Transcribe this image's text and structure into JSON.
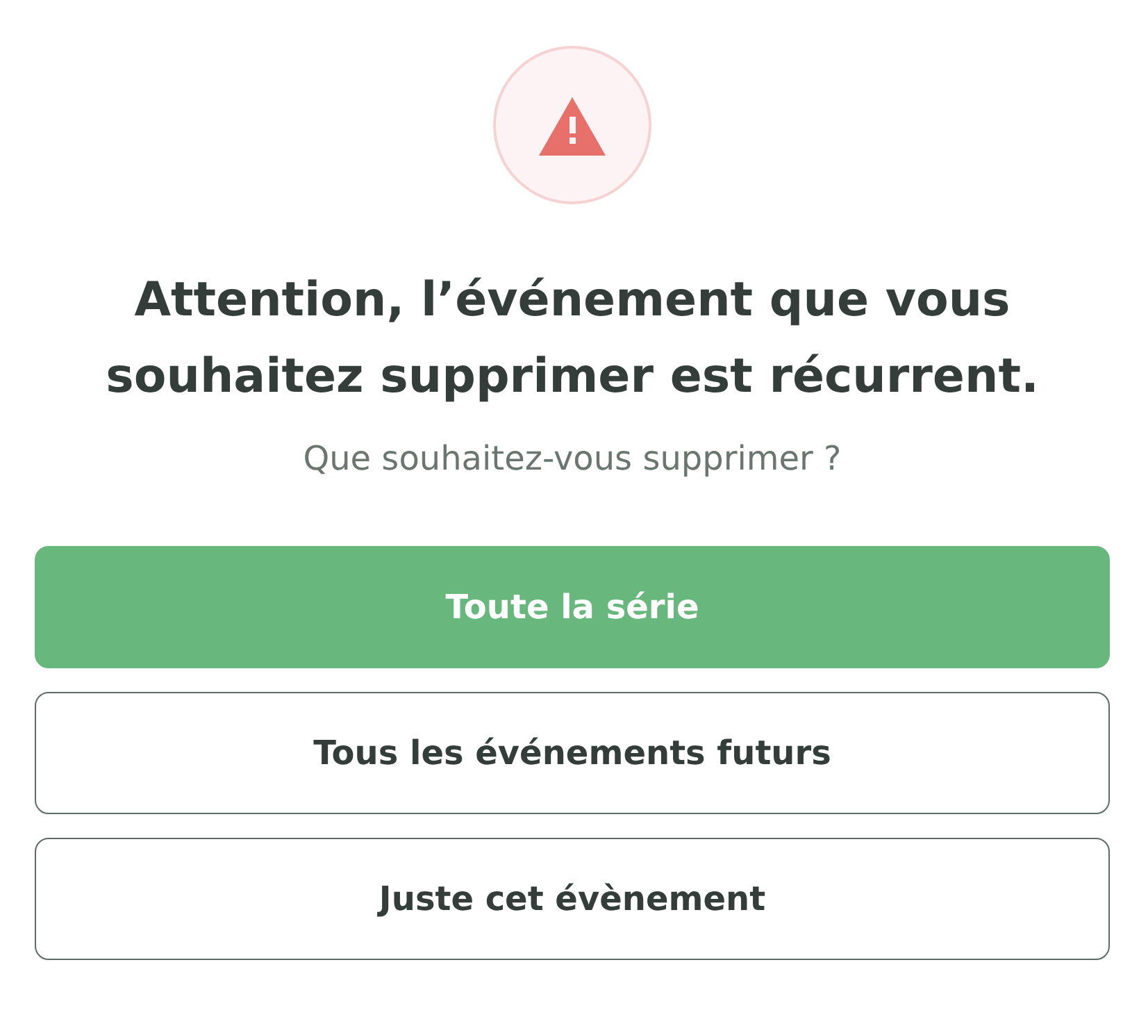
{
  "dialog": {
    "icon": {
      "kind": "warning"
    },
    "title": "Attention, l’événement que vous souhaitez supprimer est récurrent.",
    "subtitle": "Que souhaitez-vous supprimer ?"
  },
  "buttons": [
    {
      "label": "Toute la série",
      "kind": "primary"
    },
    {
      "label": "Tous les événements futurs",
      "kind": "outline"
    },
    {
      "label": "Juste cet évènement",
      "kind": "outline"
    }
  ]
}
